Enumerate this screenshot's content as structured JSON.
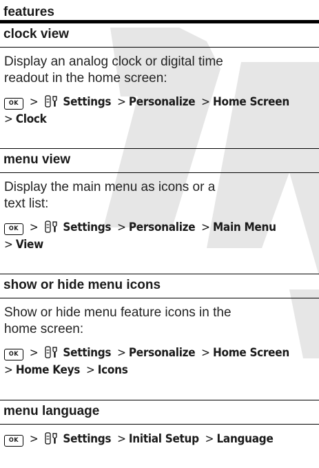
{
  "header": {
    "title": "features"
  },
  "watermark": {
    "text": "DR"
  },
  "icons": {
    "ok_key": "OK",
    "settings": "settings-icon"
  },
  "sections": [
    {
      "title": "clock view",
      "description": "Display an analog clock or digital time readout in the home screen:",
      "path": [
        "Settings",
        "Personalize",
        "Home Screen",
        "Clock"
      ]
    },
    {
      "title": "menu view",
      "description": "Display the main menu as icons or a text list:",
      "path": [
        "Settings",
        "Personalize",
        "Main Menu",
        "View"
      ]
    },
    {
      "title": "show or hide menu icons",
      "description": "Show or hide menu feature icons in the home screen:",
      "path": [
        "Settings",
        "Personalize",
        "Home Screen",
        "Home Keys",
        "Icons"
      ]
    },
    {
      "title": "menu language",
      "description": "",
      "path": [
        "Settings",
        "Initial Setup",
        "Language"
      ]
    }
  ]
}
